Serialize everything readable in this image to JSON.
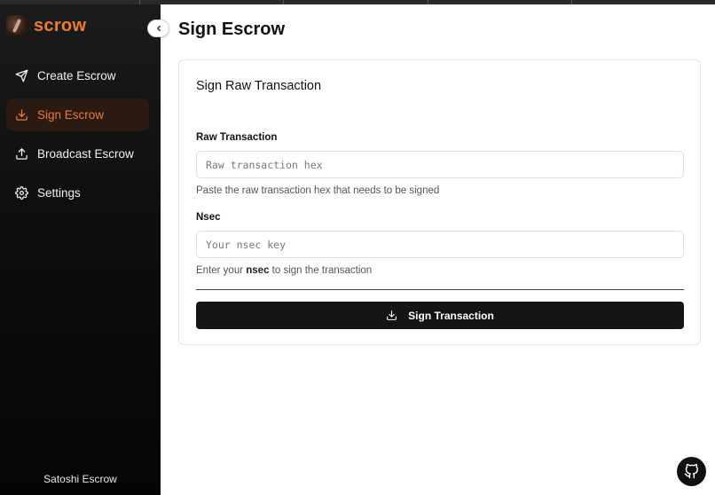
{
  "sidebar": {
    "logo_text": "scrow",
    "logo_icon": "bird-logo",
    "items": [
      {
        "label": "Create Escrow",
        "icon": "send-icon"
      },
      {
        "label": "Sign Escrow",
        "icon": "download-icon",
        "active": true
      },
      {
        "label": "Broadcast Escrow",
        "icon": "upload-icon"
      },
      {
        "label": "Settings",
        "icon": "gear-icon"
      }
    ],
    "footer": "Satoshi Escrow"
  },
  "main": {
    "title": "Sign Escrow",
    "card": {
      "title": "Sign Raw Transaction",
      "raw_tx": {
        "label": "Raw Transaction",
        "placeholder": "Raw transaction hex",
        "value": "",
        "help": "Paste the raw transaction hex that needs to be signed"
      },
      "nsec": {
        "label": "Nsec",
        "placeholder": "Your nsec key",
        "value": "",
        "help_prefix": "Enter your ",
        "help_bold": "nsec",
        "help_suffix": " to sign the transaction"
      },
      "submit_label": "Sign Transaction"
    }
  },
  "colors": {
    "accent": "#f07a2e",
    "sidebar_bg": "#0f0f0f",
    "active_bg": "#2a1a12",
    "button_bg": "#151515"
  }
}
